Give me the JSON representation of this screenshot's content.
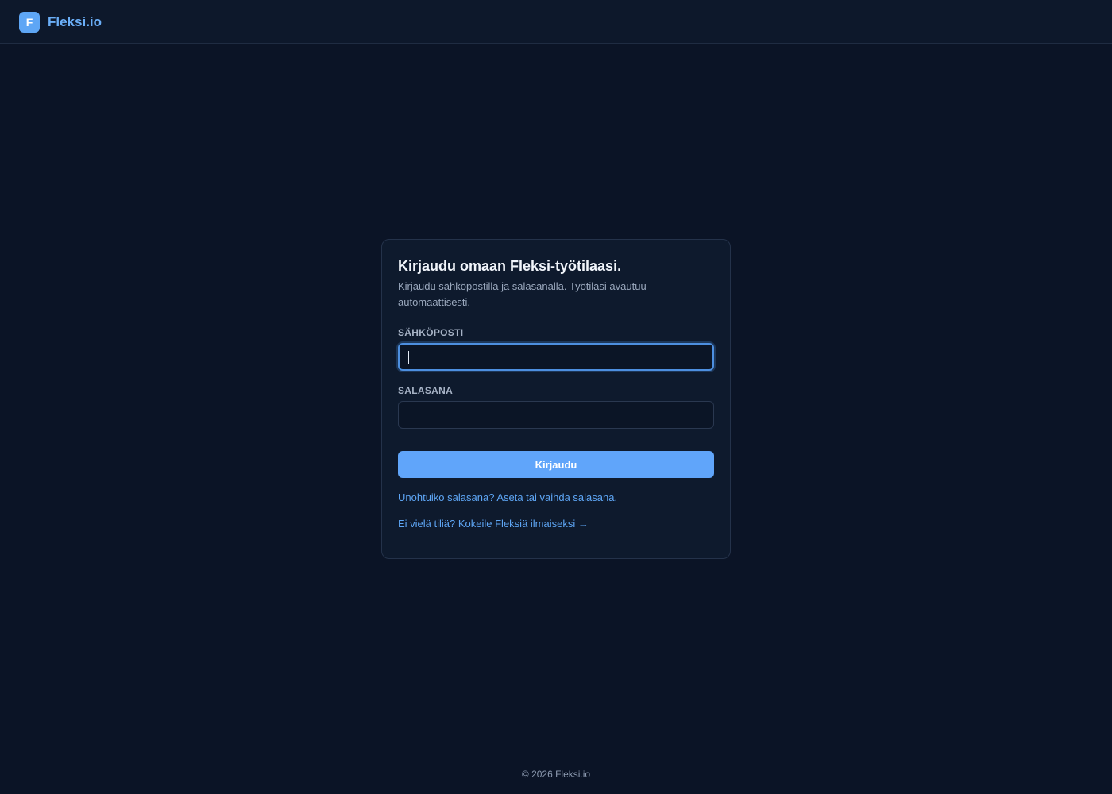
{
  "header": {
    "logo_letter": "F",
    "brand_name": "Fleksi.io"
  },
  "login_card": {
    "title": "Kirjaudu omaan Fleksi-työtilaasi.",
    "subtitle": "Kirjaudu sähköpostilla ja salasanalla. Työtilasi avautuu automaattisesti.",
    "email_label": "SÄHKÖPOSTI",
    "email_value": "",
    "password_label": "SALASANA",
    "password_value": "",
    "submit_label": "Kirjaudu",
    "forgot_link": "Unohtuiko salasana? Aseta tai vaihda salasana.",
    "signup_link": "Ei vielä tiliä? Kokeile Fleksiä ilmaiseksi →"
  },
  "footer": {
    "copyright": "© 2026 Fleksi.io"
  },
  "colors": {
    "background": "#0b1426",
    "accent": "#60a5fa",
    "link": "#5ea6f5",
    "card": "#0e1a2d"
  }
}
